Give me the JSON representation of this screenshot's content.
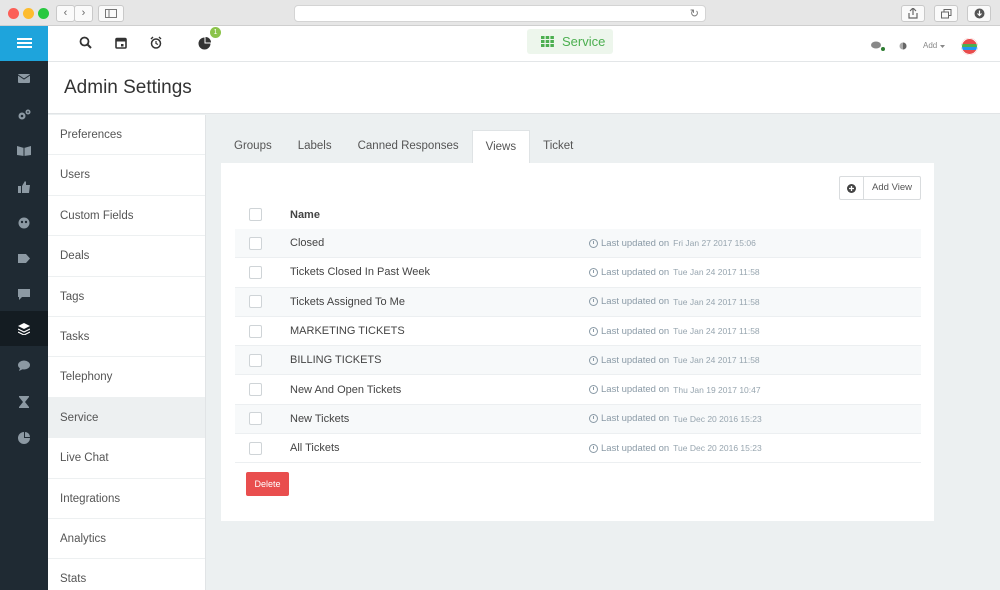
{
  "topbar": {
    "service_label": "Service",
    "notification_count": "1",
    "add_label": "Add"
  },
  "page": {
    "title": "Admin Settings"
  },
  "settings_nav": {
    "items": [
      {
        "label": "Preferences"
      },
      {
        "label": "Users"
      },
      {
        "label": "Custom Fields"
      },
      {
        "label": "Deals"
      },
      {
        "label": "Tags"
      },
      {
        "label": "Tasks"
      },
      {
        "label": "Telephony"
      },
      {
        "label": "Service",
        "active": true
      },
      {
        "label": "Live Chat"
      },
      {
        "label": "Integrations"
      },
      {
        "label": "Analytics"
      },
      {
        "label": "Stats"
      }
    ]
  },
  "tabs": [
    {
      "label": "Groups"
    },
    {
      "label": "Labels"
    },
    {
      "label": "Canned Responses"
    },
    {
      "label": "Views",
      "active": true
    },
    {
      "label": "Ticket"
    }
  ],
  "views": {
    "add_view_label": "Add View",
    "column_name": "Name",
    "updated_prefix": "Last updated on",
    "rows": [
      {
        "name": "Closed",
        "updated": "Fri Jan 27 2017 15:06"
      },
      {
        "name": "Tickets Closed In Past Week",
        "updated": "Tue Jan 24 2017 11:58"
      },
      {
        "name": "Tickets Assigned To Me",
        "updated": "Tue Jan 24 2017 11:58"
      },
      {
        "name": "MARKETING TICKETS",
        "updated": "Tue Jan 24 2017 11:58"
      },
      {
        "name": "BILLING TICKETS",
        "updated": "Tue Jan 24 2017 11:58"
      },
      {
        "name": "New And Open Tickets",
        "updated": "Thu Jan 19 2017 10:47"
      },
      {
        "name": "New Tickets",
        "updated": "Tue Dec 20 2016 15:23"
      },
      {
        "name": "All Tickets",
        "updated": "Tue Dec 20 2016 15:23"
      }
    ],
    "delete_label": "Delete"
  },
  "colors": {
    "accent": "#1ea4dc",
    "service_green": "#4caf50",
    "danger": "#e94e4e",
    "rail": "#1f2a33"
  }
}
